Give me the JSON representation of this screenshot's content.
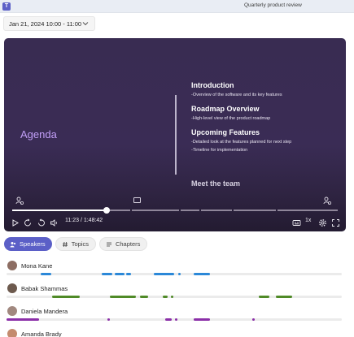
{
  "window": {
    "app_icon": "T",
    "title": "Quarterly product review"
  },
  "date_picker": {
    "value": "Jan 21, 2024 10:00 - 11:00",
    "icon": "chevron-down-icon"
  },
  "slide": {
    "agenda": "Agenda",
    "sections": [
      {
        "heading": "Introduction",
        "items": [
          "-Overview of the software and its key features"
        ]
      },
      {
        "heading": "Roadmap Overview",
        "items": [
          "-High-level view of the product roadmap"
        ]
      },
      {
        "heading": "Upcoming Features",
        "items": [
          "-Detailed look at the features planned for next step",
          "-Timeline for implementation"
        ]
      }
    ],
    "last_heading": "Meet the team"
  },
  "player": {
    "time_readout": "11:23 / 1:48:42",
    "speed": "1x",
    "progress_fraction": 0.29,
    "colors": {
      "fill": "#ffffff",
      "track": "#8f8699"
    }
  },
  "tabs": [
    {
      "label": "Speakers",
      "icon": "people-icon",
      "active": true
    },
    {
      "label": "Topics",
      "icon": "hash-icon",
      "active": false
    },
    {
      "label": "Chapters",
      "icon": "list-icon",
      "active": false
    }
  ],
  "speakers": [
    {
      "name": "Mona Kane",
      "color": "#2b88d8",
      "avatar_color": "#8d6e63"
    },
    {
      "name": "Babak Shammas",
      "color": "#4f8a27",
      "avatar_color": "#6d5a4e"
    },
    {
      "name": "Daniela Mandera",
      "color": "#8b2fa8",
      "avatar_color": "#a1887f"
    },
    {
      "name": "Amanda Brady",
      "color": "#8b2fa8",
      "avatar_color": "#c48b6e"
    }
  ]
}
